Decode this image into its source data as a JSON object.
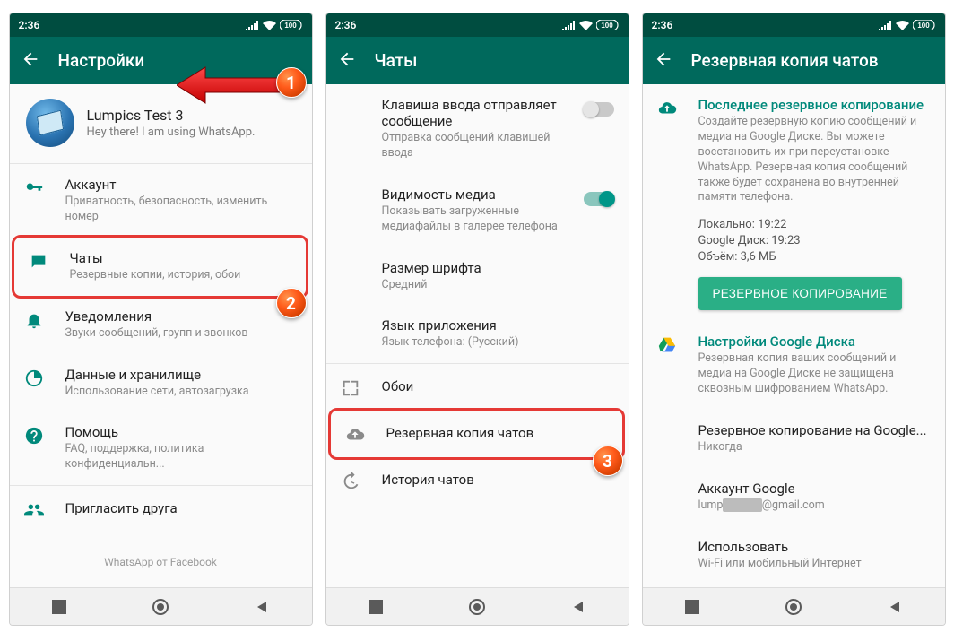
{
  "status": {
    "time": "2:36",
    "battery": "100"
  },
  "screen1": {
    "title": "Настройки",
    "profile_name": "Lumpics Test 3",
    "profile_sub": "Hey there! I am using WhatsApp.",
    "account": {
      "t": "Аккаунт",
      "s": "Приватность, безопасность, изменить номер"
    },
    "chats": {
      "t": "Чаты",
      "s": "Резервные копии, история, обои"
    },
    "notif": {
      "t": "Уведомления",
      "s": "Звуки сообщений, групп и звонков"
    },
    "data": {
      "t": "Данные и хранилище",
      "s": "Использование сети, автозагрузка"
    },
    "help": {
      "t": "Помощь",
      "s": "FAQ, поддержка, политика конфиденциальн..."
    },
    "invite": {
      "t": "Пригласить друга"
    },
    "footer": "WhatsApp от Facebook"
  },
  "screen2": {
    "title": "Чаты",
    "enter": {
      "t": "Клавиша ввода отправляет сообщение",
      "s": "Отправка сообщений клавишей ввода"
    },
    "media": {
      "t": "Видимость медиа",
      "s": "Показывать загруженные медиафайлы в галерее телефона"
    },
    "font": {
      "t": "Размер шрифта",
      "s": "Средний"
    },
    "lang": {
      "t": "Язык приложения",
      "s": "Язык телефона: (Русский)"
    },
    "wallpaper": "Обои",
    "backup": "Резервная копия чатов",
    "history": "История чатов"
  },
  "screen3": {
    "title": "Резервная копия чатов",
    "last_title": "Последнее резервное копирование",
    "last_text": "Создайте резервную копию сообщений и медиа на Google Диске. Вы можете восстановить их при переустановке WhatsApp. Резервная копия сообщений также будет сохранена во внутренней памяти телефона.",
    "local": "Локально: 19:22",
    "gdrive_time": "Google Диск: 19:23",
    "size": "Объём: 3,6 МБ",
    "button": "РЕЗЕРВНОЕ КОПИРОВАНИЕ",
    "gdrive_title": "Настройки Google Диска",
    "gdrive_text": "Резервная копия ваших сообщений и медиа на Google Диске не защищена сквозным шифрованием WhatsApp.",
    "backup_to": {
      "t": "Резервное копирование на Google...",
      "s": "Никогда"
    },
    "account": {
      "t": "Аккаунт Google",
      "s_prefix": "lump",
      "s_suffix": "@gmail.com"
    },
    "use": {
      "t": "Использовать",
      "s": "Wi-Fi или мобильный Интернет"
    }
  },
  "badges": {
    "b1": "1",
    "b2": "2",
    "b3": "3"
  }
}
